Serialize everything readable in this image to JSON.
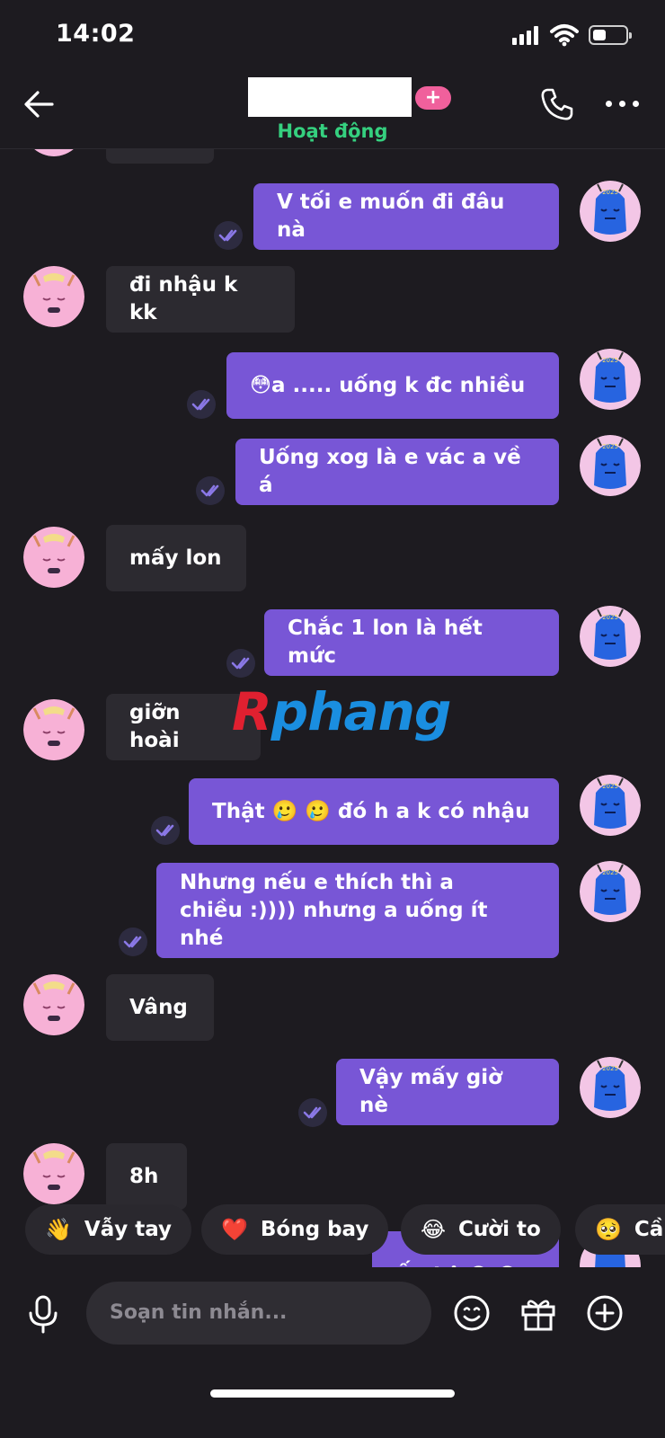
{
  "status_bar": {
    "time": "14:02"
  },
  "header": {
    "plus_label": "+",
    "status": "Hoạt động"
  },
  "messages": [
    {
      "side": "out",
      "text": "V tối e muốn đi đâu nà"
    },
    {
      "side": "in",
      "text": "đi nhậu k kk"
    },
    {
      "side": "out",
      "text": "😳a ..... uống k đc nhiều"
    },
    {
      "side": "out",
      "text": "Uống xog là e vác a về á"
    },
    {
      "side": "in",
      "text": "mấy lon"
    },
    {
      "side": "out",
      "text": "Chắc 1 lon là hết mức"
    },
    {
      "side": "in",
      "text": "giỡn hoài"
    },
    {
      "side": "out",
      "text": "Thật 🥲 🥲  đó h a k có nhậu"
    },
    {
      "side": "out",
      "text": "Nhưng nếu e thích thì a\nchiều :)))) nhưng a uống ít nhé"
    },
    {
      "side": "in",
      "text": "Vâng"
    },
    {
      "side": "out",
      "text": "Vậy mấy giờ nè"
    },
    {
      "side": "in",
      "text": "8h"
    },
    {
      "side": "out",
      "text": "Ấu kê 😆 😆"
    }
  ],
  "watermark": {
    "first": "R",
    "rest": "phang"
  },
  "quick_replies": [
    {
      "emoji": "👋",
      "label": "Vẫy tay"
    },
    {
      "emoji": "❤️",
      "label": "Bóng bay"
    },
    {
      "emoji": "😂",
      "label": "Cười to"
    },
    {
      "emoji": "🥺",
      "label": "Cầ"
    }
  ],
  "composer": {
    "placeholder": "Soạn tin nhắn..."
  },
  "colors": {
    "background": "#1d1b20",
    "incoming_bubble": "#2c2a30",
    "outgoing_bubble": "#7856d6",
    "online_status": "#35d07f",
    "badge": "#f0609c"
  },
  "icons": {
    "back": "arrow-left-icon",
    "call": "phone-icon",
    "more": "more-horizontal-icon",
    "read": "double-check-icon",
    "mic": "microphone-icon",
    "emoji": "smiley-icon",
    "gift": "gift-icon",
    "add": "plus-circle-icon"
  }
}
